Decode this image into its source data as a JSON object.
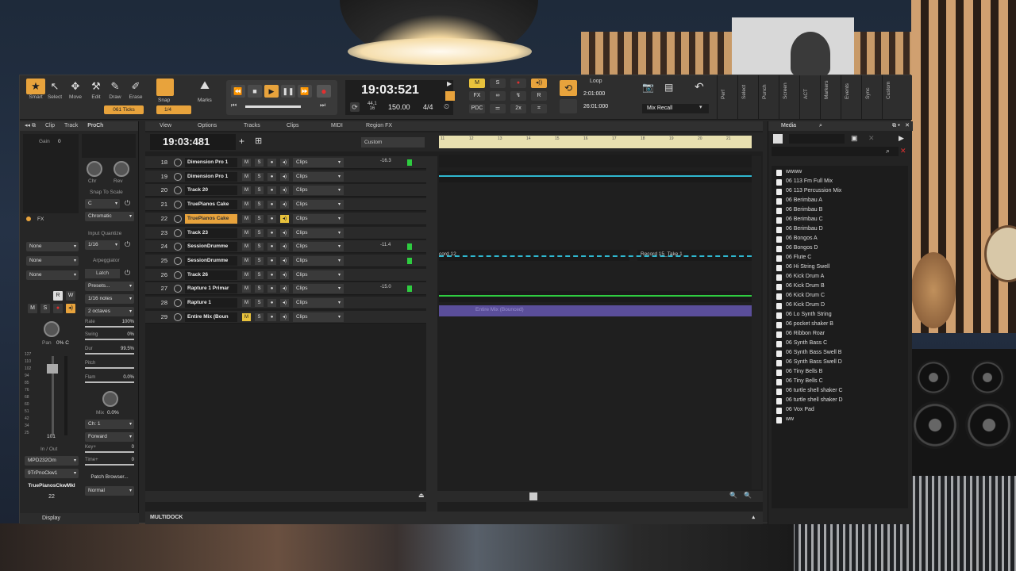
{
  "toolbar": {
    "tools": [
      "Smart",
      "Select",
      "Move",
      "Edit",
      "Draw",
      "Erase"
    ],
    "ticks_label": "061 Ticks",
    "snap_label": "Snap",
    "snap_value": "1/4",
    "marks_label": "Marks"
  },
  "transport": {
    "time": "19:03:521",
    "sample_rate_top": "44.1",
    "sample_rate_bottom": "16",
    "tempo": "150.00",
    "signature": "4/4"
  },
  "mix": {
    "m": "M",
    "s": "S",
    "fx": "FX",
    "r": "R",
    "pdc": "PDC",
    "two_x": "2x"
  },
  "loop": {
    "label": "Loop",
    "start": "2:01:000",
    "end": "26:01:000"
  },
  "mix_recall": "Mix Recall",
  "side_tabs": [
    "Perf",
    "Select",
    "Punch",
    "Screen",
    "ACT",
    "Markers",
    "Events",
    "Sync",
    "Custom"
  ],
  "inspector": {
    "tabs": [
      "Clip",
      "Track",
      "ProCh"
    ],
    "gain_label": "Gain",
    "gain_value": "0",
    "chr_label": "Chr",
    "rev_label": "Rev",
    "fx_label": "FX",
    "snap_to_scale": "Snap To Scale",
    "scale_root": "C",
    "scale_type": "Chromatic",
    "input_quantize": "Input Quantize",
    "iq_value": "1/16",
    "none_1": "None",
    "none_2": "None",
    "none_3": "None",
    "arpeggiator": "Arpeggiator",
    "latch": "Latch",
    "presets": "Presets...",
    "notes": "1/16 notes",
    "octaves": "2 octaves",
    "rate_label": "Rate",
    "rate_value": "100%",
    "swing_label": "Swing",
    "swing_value": "0%",
    "dur_label": "Dur",
    "dur_value": "99.5%",
    "pitch_label": "Pitch",
    "flam_label": "Flam",
    "flam_value": "0.0%",
    "mix_label": "Mix",
    "mix_value": "0.0%",
    "pan_label": "Pan",
    "pan_value": "0% C",
    "r": "R",
    "w": "W",
    "m": "M",
    "s": "S",
    "fader_value": "101",
    "fader_scale": [
      "127",
      "110",
      "102",
      "94",
      "85",
      "76",
      "68",
      "60",
      "51",
      "42",
      "34",
      "25"
    ],
    "ch": "Ch: 1",
    "forward": "Forward",
    "key": "Key+",
    "key_value": "0",
    "time": "Time+",
    "time_value": "0",
    "in_out": "In / Out",
    "input": "MPD232Om",
    "output": "9TrPnoCkw1",
    "patch_browser": "Patch Browser...",
    "normal": "Normal",
    "track_name": "TruePianosCkwMkI",
    "track_num": "22",
    "display_tab": "Display"
  },
  "trackview": {
    "menu": [
      "View",
      "Options",
      "Tracks",
      "Clips",
      "MIDI",
      "Region FX"
    ],
    "time": "19:03:481",
    "custom_label": "Custom",
    "ruler": [
      "11",
      "12",
      "13",
      "14",
      "15",
      "16",
      "17",
      "18",
      "19",
      "20",
      "21"
    ]
  },
  "tracks": [
    {
      "num": "18",
      "name": "Dimension Pro 1",
      "clips": "Clips",
      "vol": "-16.3",
      "meter": true
    },
    {
      "num": "19",
      "name": "Dimension Pro 1",
      "clips": "Clips",
      "vol": "",
      "meter": false
    },
    {
      "num": "20",
      "name": "Track 20",
      "clips": "Clips",
      "vol": "",
      "meter": false
    },
    {
      "num": "21",
      "name": "TruePianos Cake",
      "clips": "Clips",
      "vol": "",
      "meter": false
    },
    {
      "num": "22",
      "name": "TruePianos Cake",
      "clips": "Clips",
      "vol": "",
      "meter": false,
      "selected": true
    },
    {
      "num": "23",
      "name": "Track 23",
      "clips": "Clips",
      "vol": "",
      "meter": false
    },
    {
      "num": "24",
      "name": "SessionDrumme",
      "clips": "Clips",
      "vol": "-11.4",
      "meter": true
    },
    {
      "num": "25",
      "name": "SessionDrumme",
      "clips": "Clips",
      "vol": "",
      "meter": true
    },
    {
      "num": "26",
      "name": "Track 26",
      "clips": "Clips",
      "vol": "",
      "meter": false
    },
    {
      "num": "27",
      "name": "Rapture 1 Primar",
      "clips": "Clips",
      "vol": "-15.0",
      "meter": true
    },
    {
      "num": "28",
      "name": "Rapture 1",
      "clips": "Clips",
      "vol": "",
      "meter": false
    },
    {
      "num": "29",
      "name": "Entire Mix (Boun",
      "clips": "Clips",
      "vol": "",
      "meter": false,
      "mute": true
    }
  ],
  "clip_labels": {
    "record_a": "cord 12",
    "record_b": "Record 15_Take 1",
    "bounce": "Entire Mix (Bounced)"
  },
  "media": {
    "title": "Media",
    "files": [
      "wwww",
      "06 113 Fm Full Mix",
      "06 113 Percussion Mix",
      "06 Berimbau A",
      "06 Berimbau B",
      "06 Berimbau C",
      "06 Berimbau D",
      "06 Bongos A",
      "06 Bongos D",
      "06 Flute C",
      "06 Hi String Swell",
      "06 Kick Drum A",
      "06 Kick Drum B",
      "06 Kick Drum C",
      "06 Kick Drum D",
      "06 Lo Synth String",
      "06 pocket shaker B",
      "06 Ribbon Roar",
      "06 Synth Bass C",
      "06 Synth Bass Swell B",
      "06 Synth Bass Swell D",
      "06 Tiny Bells B",
      "06 Tiny Bells C",
      "06 turtle shell shaker C",
      "06 turtle shell shaker D",
      "06 Vox Pad",
      "ww"
    ]
  },
  "multidock": "MULTIDOCK",
  "colors": {
    "accent": "#e8a33c",
    "meter": "#2ecc40",
    "midi_line": "#2fb8d0",
    "bounce_clip": "#5a4e9a"
  }
}
